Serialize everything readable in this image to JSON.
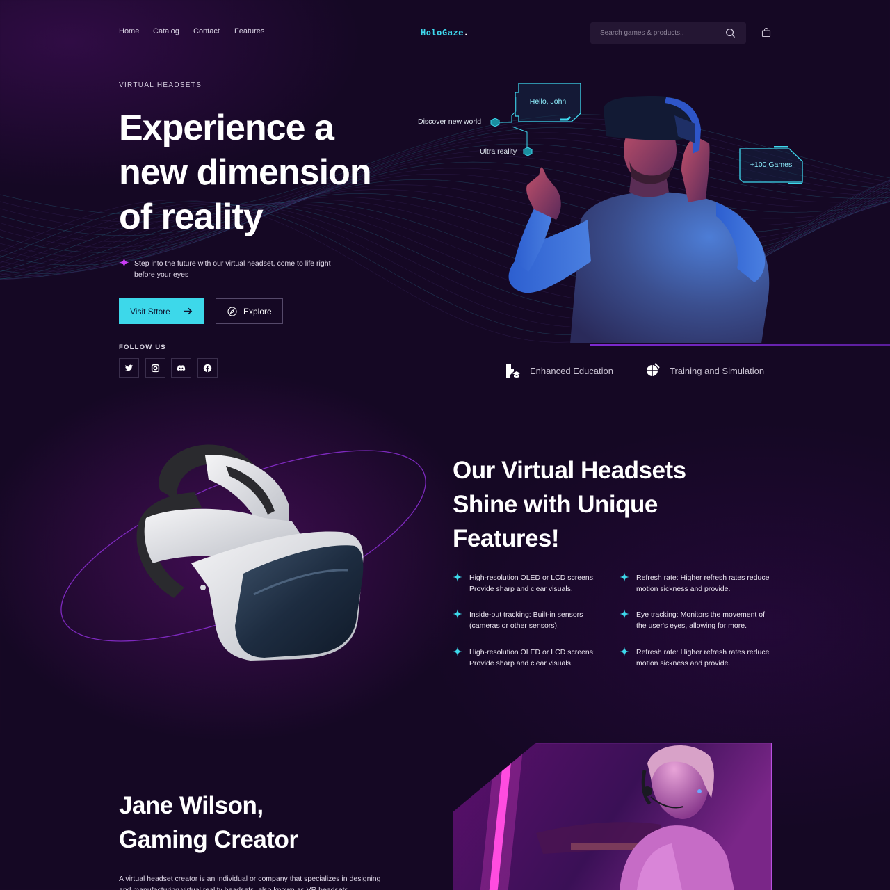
{
  "nav": {
    "links": [
      "Home",
      "Catalog",
      "Contact",
      "Features"
    ],
    "logo_main": "HoloGaze",
    "logo_dot": ".",
    "search_placeholder": "Search games & products.."
  },
  "hero": {
    "eyebrow": "VIRTUAL HEADSETS",
    "title_lines": [
      "Experience a",
      "new dimension",
      "of reality"
    ],
    "description": "Step into the future with our virtual headset, come to life right before your eyes",
    "primary_button": "Visit Sttore",
    "secondary_button": "Explore",
    "follow_label": "FOLLOW US",
    "social": [
      "twitter-icon",
      "instagram-icon",
      "discord-icon",
      "facebook-icon"
    ],
    "hud": {
      "greeting": "Hello, John",
      "discover": "Discover new world",
      "ultra": "Ultra reality",
      "games": "+100 Games"
    },
    "features": [
      "Enhanced Education",
      "Training and Simulation"
    ]
  },
  "features_section": {
    "title_lines": [
      "Our Virtual Headsets",
      "Shine with Unique",
      "Features!"
    ],
    "specs": [
      "High-resolution OLED or LCD screens: Provide sharp and clear visuals.",
      "Refresh rate: Higher refresh rates reduce motion sickness and provide.",
      "Inside-out tracking: Built-in sensors (cameras or other sensors).",
      "Eye tracking: Monitors the movement of the user's eyes, allowing for more.",
      "High-resolution OLED or LCD screens: Provide sharp and clear visuals.",
      "Refresh rate: Higher refresh rates reduce motion sickness and provide."
    ]
  },
  "creator": {
    "title_lines": [
      "Jane Wilson,",
      "Gaming Creator"
    ],
    "description": "A virtual headset creator is an individual or company that specializes in designing and manufacturing virtual reality headsets, also known as VR headsets."
  },
  "colors": {
    "background": "#150824",
    "accent_cyan": "#3dd8ea",
    "accent_purple": "#7d2ad0",
    "accent_pink": "#d23bff"
  }
}
